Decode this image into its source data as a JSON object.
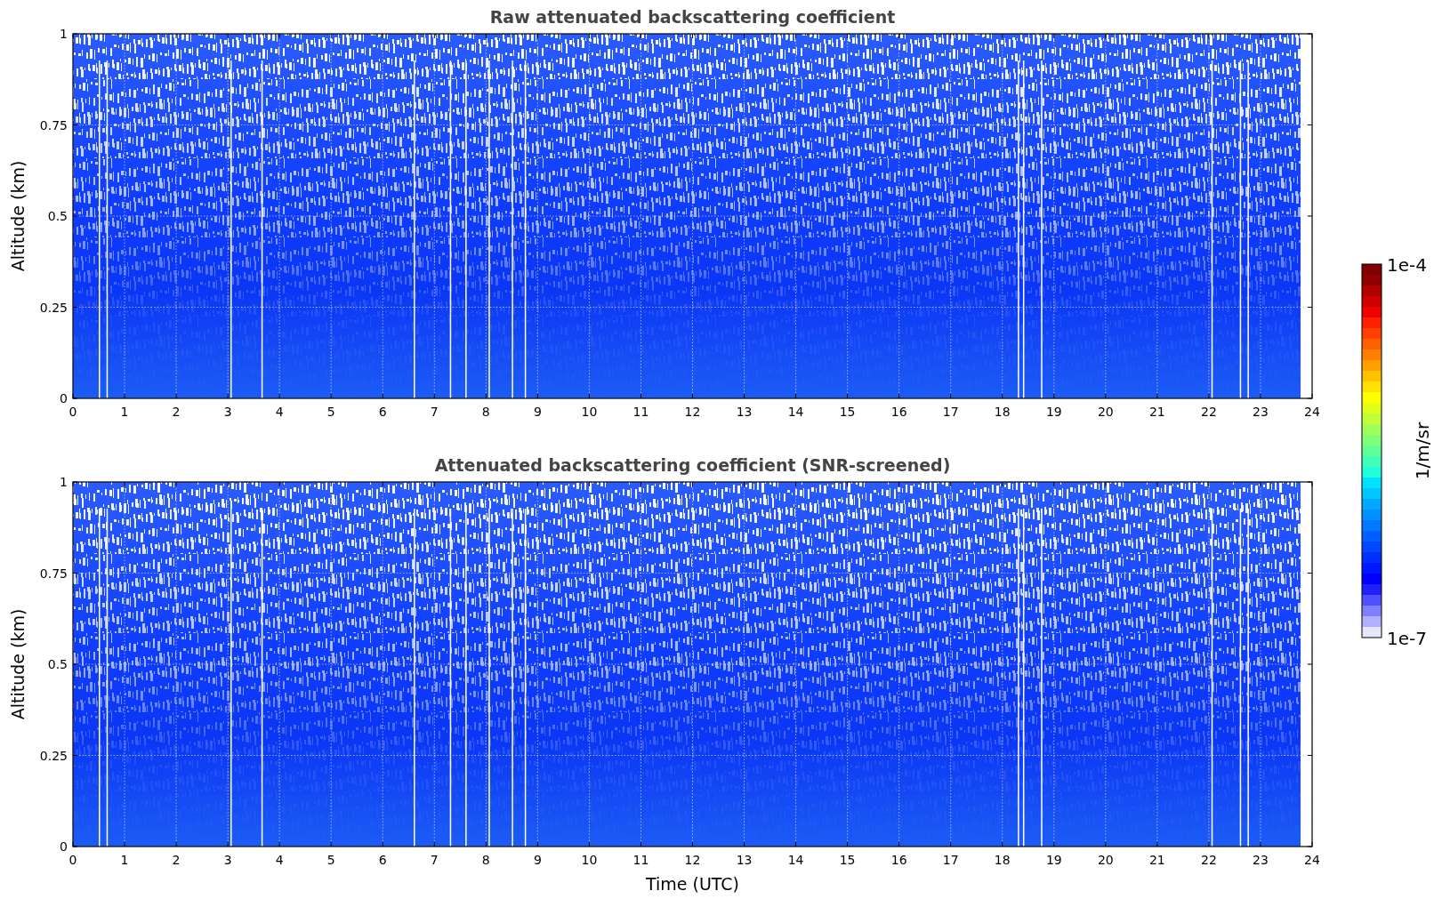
{
  "panels": [
    {
      "title": "Raw attenuated backscattering coefficient",
      "y_axis_label": "Altitude (km)",
      "y_tick_labels": [
        "1",
        "0.75",
        "0.5",
        "0.25",
        "0"
      ],
      "x_tick_labels": [
        "0",
        "1",
        "2",
        "3",
        "4",
        "5",
        "6",
        "7",
        "8",
        "9",
        "10",
        "11",
        "12",
        "13",
        "14",
        "15",
        "16",
        "17",
        "18",
        "19",
        "20",
        "21",
        "22",
        "23",
        "24"
      ]
    },
    {
      "title": "Attenuated backscattering coefficient (SNR-screened)",
      "y_axis_label": "Altitude (km)",
      "y_tick_labels": [
        "1",
        "0.75",
        "0.5",
        "0.25",
        "0"
      ],
      "x_tick_labels": [
        "0",
        "1",
        "2",
        "3",
        "4",
        "5",
        "6",
        "7",
        "8",
        "9",
        "10",
        "11",
        "12",
        "13",
        "14",
        "15",
        "16",
        "17",
        "18",
        "19",
        "20",
        "21",
        "22",
        "23",
        "24"
      ],
      "x_axis_label": "Time (UTC)"
    }
  ],
  "colorbar": {
    "label": "1/m/sr",
    "max_label": "1e-4",
    "min_label": "1e-7"
  }
}
